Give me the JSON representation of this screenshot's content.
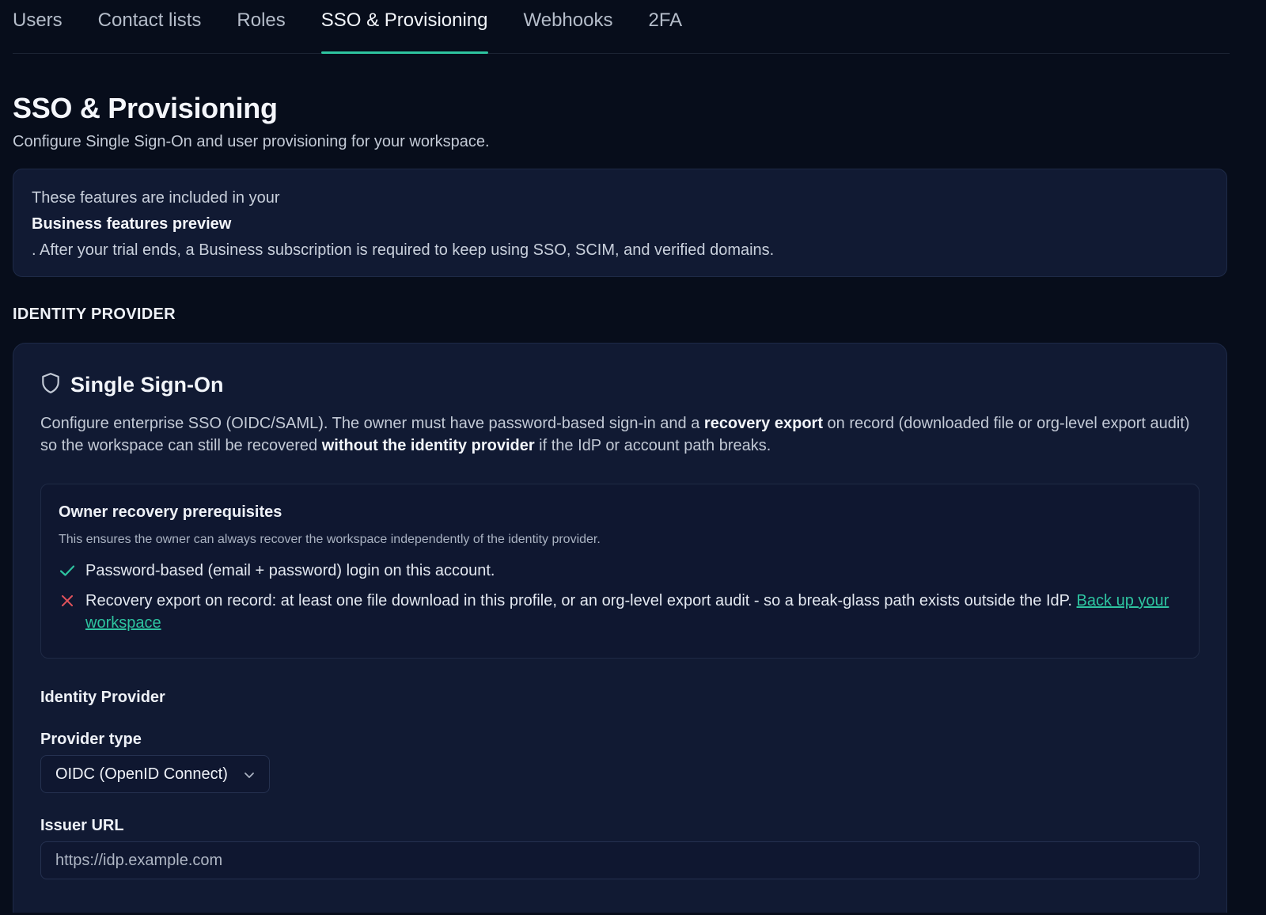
{
  "tabs": [
    {
      "label": "Users"
    },
    {
      "label": "Contact lists"
    },
    {
      "label": "Roles"
    },
    {
      "label": "SSO & Provisioning",
      "active": true
    },
    {
      "label": "Webhooks"
    },
    {
      "label": "2FA"
    }
  ],
  "page": {
    "title": "SSO & Provisioning",
    "subtitle": "Configure Single Sign-On and user provisioning for your workspace."
  },
  "notice": {
    "line1": "These features are included in your",
    "strong": "Business features preview",
    "line3": ". After your trial ends, a Business subscription is required to keep using SSO, SCIM, and verified domains."
  },
  "section_label": "IDENTITY PROVIDER",
  "sso_card": {
    "icon": "shield-icon",
    "title": "Single Sign-On",
    "desc_part1": "Configure enterprise SSO (OIDC/SAML). The owner must have password-based sign-in and a ",
    "desc_bold1": "recovery export",
    "desc_part2": " on record (downloaded file or org-level export audit) so the workspace can still be recovered ",
    "desc_bold2": "without the identity provider",
    "desc_part3": " if the IdP or account path breaks."
  },
  "prereq": {
    "title": "Owner recovery prerequisites",
    "subtitle": "This ensures the owner can always recover the workspace independently of the identity provider.",
    "items": [
      {
        "status": "ok",
        "icon": "check-icon",
        "color": "#2ec4a0",
        "text": "Password-based (email + password) login on this account."
      },
      {
        "status": "missing",
        "icon": "x-icon",
        "color": "#e0525b",
        "text": "Recovery export on record: at least one file download in this profile, or an org-level export audit - so a break-glass path exists outside the IdP. ",
        "link": "Back up your workspace"
      }
    ]
  },
  "form": {
    "heading": "Identity Provider",
    "provider_type_label": "Provider type",
    "provider_type_value": "OIDC (OpenID Connect)",
    "issuer_label": "Issuer URL",
    "issuer_placeholder": "https://idp.example.com"
  },
  "colors": {
    "background": "#070d1b",
    "card": "#111a33",
    "accent": "#2ec4a0",
    "error": "#e0525b"
  }
}
